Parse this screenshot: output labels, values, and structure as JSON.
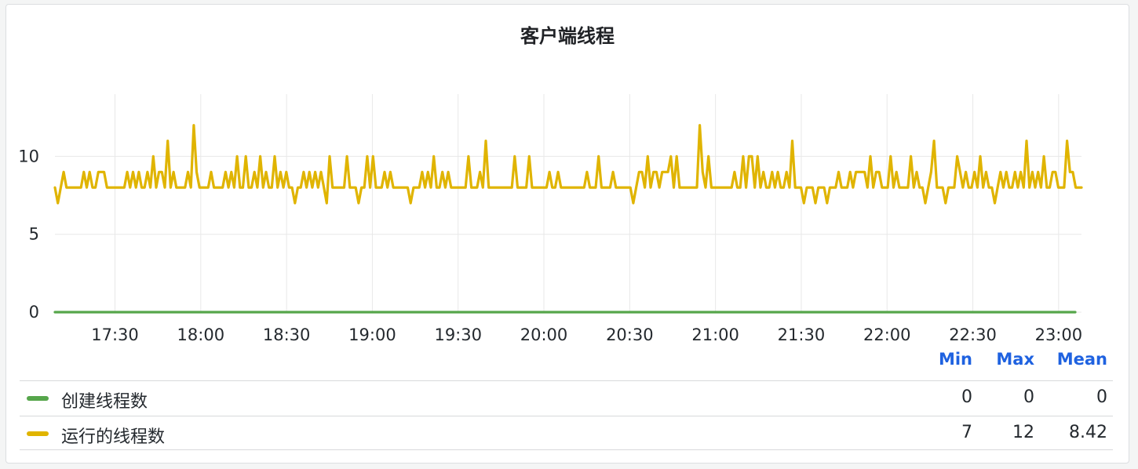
{
  "chart_data": {
    "type": "line",
    "title": "客户端线程",
    "x_ticks": [
      "17:30",
      "18:00",
      "18:30",
      "19:00",
      "19:30",
      "20:00",
      "20:30",
      "21:00",
      "21:30",
      "22:00",
      "22:30",
      "23:00"
    ],
    "x_range": [
      "17:09",
      "23:08"
    ],
    "y_ticks": [
      "0",
      "5",
      "10"
    ],
    "ylim": [
      0,
      14
    ],
    "grid": true,
    "series": [
      {
        "name": "创建线程数",
        "color": "#56a64b",
        "constant": 0,
        "min": "0",
        "max": "0",
        "mean": "0"
      },
      {
        "name": "运行的线程数",
        "color": "#e0b400",
        "min": "7",
        "max": "12",
        "mean": "8.42",
        "values": [
          8,
          7,
          8,
          9,
          8,
          8,
          8,
          8,
          8,
          8,
          9,
          8,
          9,
          8,
          8,
          9,
          9,
          9,
          8,
          8,
          8,
          8,
          8,
          8,
          8,
          9,
          8,
          9,
          8,
          9,
          8,
          8,
          9,
          8,
          10,
          8,
          9,
          9,
          8,
          11,
          8,
          9,
          8,
          8,
          8,
          8,
          9,
          8,
          12,
          9,
          8,
          8,
          8,
          8,
          9,
          8,
          8,
          8,
          8,
          9,
          8,
          9,
          8,
          10,
          8,
          8,
          10,
          8,
          8,
          9,
          8,
          10,
          8,
          9,
          8,
          8,
          10,
          8,
          9,
          8,
          9,
          8,
          8,
          7,
          8,
          8,
          9,
          8,
          9,
          8,
          9,
          8,
          9,
          8,
          7,
          10,
          8,
          8,
          8,
          8,
          8,
          10,
          8,
          8,
          8,
          7,
          8,
          8,
          10,
          8,
          10,
          8,
          8,
          8,
          9,
          8,
          9,
          8,
          8,
          8,
          8,
          8,
          8,
          7,
          8,
          8,
          8,
          9,
          8,
          9,
          8,
          10,
          8,
          8,
          9,
          8,
          9,
          8,
          8,
          8,
          8,
          8,
          8,
          10,
          8,
          8,
          8,
          9,
          8,
          11,
          8,
          8,
          8,
          8,
          8,
          8,
          8,
          8,
          8,
          10,
          8,
          8,
          8,
          8,
          10,
          8,
          8,
          8,
          8,
          8,
          8,
          9,
          8,
          8,
          9,
          8,
          8,
          8,
          8,
          8,
          8,
          8,
          8,
          8,
          9,
          8,
          8,
          8,
          10,
          8,
          8,
          8,
          8,
          9,
          8,
          8,
          8,
          8,
          8,
          8,
          7,
          8,
          9,
          9,
          8,
          10,
          8,
          9,
          9,
          8,
          9,
          9,
          9,
          10,
          8,
          10,
          8,
          8,
          8,
          8,
          8,
          8,
          8,
          12,
          9,
          8,
          10,
          8,
          8,
          8,
          8,
          8,
          8,
          8,
          8,
          9,
          8,
          8,
          10,
          8,
          10,
          10,
          8,
          10,
          8,
          9,
          8,
          8,
          9,
          8,
          9,
          8,
          8,
          9,
          8,
          11,
          8,
          8,
          8,
          7,
          8,
          8,
          8,
          7,
          8,
          8,
          8,
          7,
          8,
          8,
          8,
          9,
          8,
          8,
          8,
          9,
          8,
          9,
          9,
          9,
          9,
          8,
          10,
          8,
          9,
          9,
          8,
          8,
          8,
          10,
          8,
          9,
          8,
          8,
          8,
          8,
          10,
          8,
          9,
          8,
          8,
          7,
          8,
          9,
          11,
          8,
          8,
          8,
          7,
          8,
          8,
          8,
          10,
          9,
          8,
          9,
          8,
          8,
          9,
          8,
          10,
          8,
          9,
          8,
          8,
          7,
          8,
          9,
          8,
          9,
          8,
          8,
          9,
          8,
          9,
          8,
          11,
          8,
          9,
          8,
          9,
          8,
          10,
          8,
          8,
          9,
          9,
          8,
          8,
          8,
          11,
          9,
          9,
          8,
          8,
          8
        ]
      }
    ]
  },
  "legend": {
    "headers": {
      "min": "Min",
      "max": "Max",
      "mean": "Mean"
    }
  }
}
